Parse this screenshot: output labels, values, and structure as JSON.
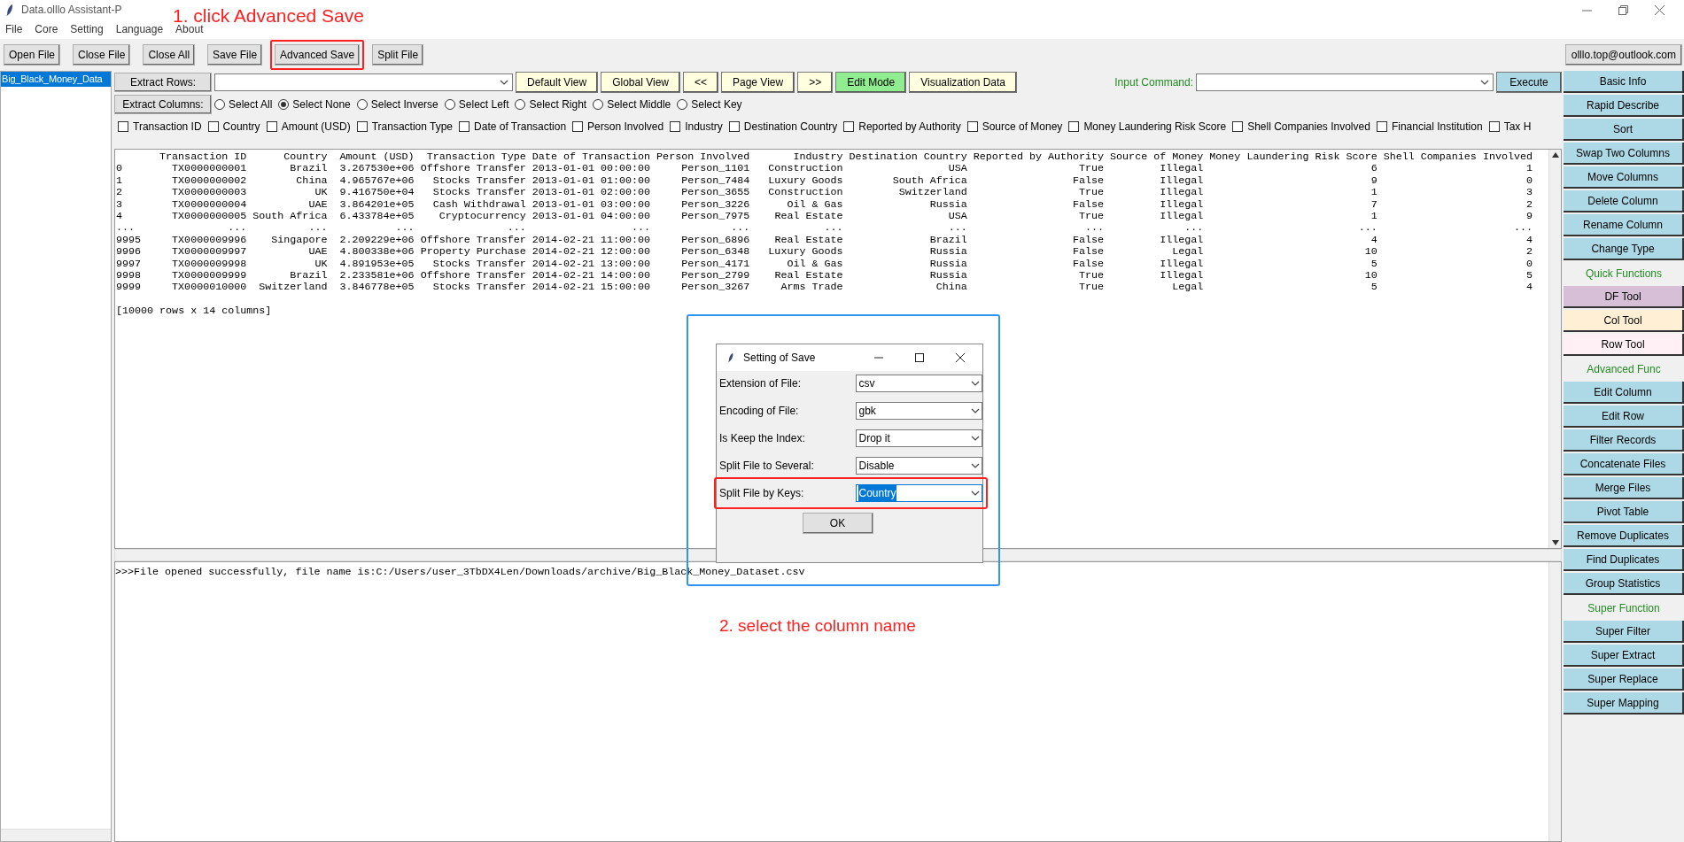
{
  "window": {
    "title": "Data.olllo Assistant-P"
  },
  "menu": [
    "File",
    "Core",
    "Setting",
    "Language",
    "About"
  ],
  "annotations": {
    "step_1": "1. click Advanced Save",
    "step_2": "2. select the column name"
  },
  "toolbar": [
    {
      "label": "Open File",
      "highlighted": false
    },
    {
      "label": "Close File",
      "highlighted": false
    },
    {
      "label": "Close All",
      "highlighted": false
    },
    {
      "label": "Save File",
      "highlighted": false
    },
    {
      "label": "Advanced Save",
      "highlighted": true
    },
    {
      "label": "Split File",
      "highlighted": false
    }
  ],
  "account": "olllo.top@outlook.com",
  "file_list": [
    {
      "label": "Big_Black_Money_Data",
      "selected": true
    }
  ],
  "extract_rows": {
    "label": "Extract Rows:"
  },
  "view_buttons": [
    {
      "label": "Default View",
      "color": "#ffffe0"
    },
    {
      "label": "Global View",
      "color": "#ffffe0"
    },
    {
      "label": "<<",
      "color": "#ffffe0"
    },
    {
      "label": "Page View",
      "color": "#ffffe0"
    },
    {
      "label": ">>",
      "color": "#ffffe0"
    },
    {
      "label": "Edit Mode",
      "color": "#90ee90"
    },
    {
      "label": "Visualization Data",
      "color": "#ffffe0"
    }
  ],
  "command": {
    "label": "Input Command:",
    "button": "Execute"
  },
  "extract_columns": {
    "label": "Extract Columns:"
  },
  "radios": [
    {
      "label": "Select All",
      "selected": false
    },
    {
      "label": "Select None",
      "selected": true
    },
    {
      "label": "Select Inverse",
      "selected": false
    },
    {
      "label": "Select Left",
      "selected": false
    },
    {
      "label": "Select Right",
      "selected": false
    },
    {
      "label": "Select Middle",
      "selected": false
    },
    {
      "label": "Select Key",
      "selected": false
    }
  ],
  "column_checks": [
    {
      "label": "Transaction ID",
      "checked": false
    },
    {
      "label": "Country",
      "checked": false
    },
    {
      "label": "Amount (USD)",
      "checked": false
    },
    {
      "label": "Transaction Type",
      "checked": false
    },
    {
      "label": "Date of Transaction",
      "checked": false
    },
    {
      "label": "Person Involved",
      "checked": false
    },
    {
      "label": "Industry",
      "checked": false
    },
    {
      "label": "Destination Country",
      "checked": false
    },
    {
      "label": "Reported by Authority",
      "checked": false
    },
    {
      "label": "Source of Money",
      "checked": false
    },
    {
      "label": "Money Laundering Risk Score",
      "checked": false
    },
    {
      "label": "Shell Companies Involved",
      "checked": false
    },
    {
      "label": "Financial Institution",
      "checked": false
    },
    {
      "label": "Tax H",
      "checked": false
    }
  ],
  "table": {
    "columns": [
      "Transaction ID",
      "Country",
      "Amount (USD)",
      "Transaction Type",
      "Date of Transaction",
      "Person Involved",
      "Industry",
      "Destination Country",
      "Reported by Authority",
      "Source of Money",
      "Money Laundering Risk Score",
      "Shell Companies Involved"
    ],
    "rows": [
      {
        "index": "0",
        "cells": [
          "TX0000000001",
          "Brazil",
          "3.267530e+06",
          "Offshore Transfer",
          "2013-01-01 00:00:00",
          "Person_1101",
          "Construction",
          "USA",
          "True",
          "Illegal",
          "6",
          "1"
        ]
      },
      {
        "index": "1",
        "cells": [
          "TX0000000002",
          "China",
          "4.965767e+06",
          "Stocks Transfer",
          "2013-01-01 01:00:00",
          "Person_7484",
          "Luxury Goods",
          "South Africa",
          "False",
          "Illegal",
          "9",
          "0"
        ]
      },
      {
        "index": "2",
        "cells": [
          "TX0000000003",
          "UK",
          "9.416750e+04",
          "Stocks Transfer",
          "2013-01-01 02:00:00",
          "Person_3655",
          "Construction",
          "Switzerland",
          "True",
          "Illegal",
          "1",
          "3"
        ]
      },
      {
        "index": "3",
        "cells": [
          "TX0000000004",
          "UAE",
          "3.864201e+05",
          "Cash Withdrawal",
          "2013-01-01 03:00:00",
          "Person_3226",
          "Oil & Gas",
          "Russia",
          "False",
          "Illegal",
          "7",
          "2"
        ]
      },
      {
        "index": "4",
        "cells": [
          "TX0000000005",
          "South Africa",
          "6.433784e+05",
          "Cryptocurrency",
          "2013-01-01 04:00:00",
          "Person_7975",
          "Real Estate",
          "USA",
          "True",
          "Illegal",
          "1",
          "9"
        ]
      },
      {
        "index": "...",
        "cells": [
          "...",
          "...",
          "...",
          "...",
          "...",
          "...",
          "...",
          "...",
          "...",
          "...",
          "...",
          "..."
        ]
      },
      {
        "index": "9995",
        "cells": [
          "TX0000009996",
          "Singapore",
          "2.209229e+06",
          "Offshore Transfer",
          "2014-02-21 11:00:00",
          "Person_6896",
          "Real Estate",
          "Brazil",
          "False",
          "Illegal",
          "4",
          "4"
        ]
      },
      {
        "index": "9996",
        "cells": [
          "TX0000009997",
          "UAE",
          "4.800338e+06",
          "Property Purchase",
          "2014-02-21 12:00:00",
          "Person_6348",
          "Luxury Goods",
          "Russia",
          "False",
          "Legal",
          "10",
          "2"
        ]
      },
      {
        "index": "9997",
        "cells": [
          "TX0000009998",
          "UK",
          "4.891953e+05",
          "Stocks Transfer",
          "2014-02-21 13:00:00",
          "Person_4171",
          "Oil & Gas",
          "Russia",
          "False",
          "Illegal",
          "5",
          "0"
        ]
      },
      {
        "index": "9998",
        "cells": [
          "TX0000009999",
          "Brazil",
          "2.233581e+06",
          "Offshore Transfer",
          "2014-02-21 14:00:00",
          "Person_2799",
          "Real Estate",
          "Russia",
          "True",
          "Illegal",
          "10",
          "5"
        ]
      },
      {
        "index": "9999",
        "cells": [
          "TX0000010000",
          "Switzerland",
          "3.846778e+05",
          "Stocks Transfer",
          "2014-02-21 15:00:00",
          "Person_3267",
          "Arms Trade",
          "China",
          "True",
          "Legal",
          "5",
          "4"
        ]
      }
    ],
    "summary": "[10000 rows x 14 columns]"
  },
  "output": ">>>File opened successfully, file name is:C:/Users/user_3TbDX4Len/Downloads/archive/Big_Black_Money_Dataset.csv",
  "sidebar": [
    {
      "kind": "button",
      "label": "Basic Info",
      "color": "#add8e6"
    },
    {
      "kind": "button",
      "label": "Rapid Describe",
      "color": "#add8e6"
    },
    {
      "kind": "button",
      "label": "Sort",
      "color": "#add8e6"
    },
    {
      "kind": "button",
      "label": "Swap Two Columns",
      "color": "#add8e6"
    },
    {
      "kind": "button",
      "label": "Move Columns",
      "color": "#add8e6"
    },
    {
      "kind": "button",
      "label": "Delete Column",
      "color": "#add8e6"
    },
    {
      "kind": "button",
      "label": "Rename Column",
      "color": "#add8e6"
    },
    {
      "kind": "button",
      "label": "Change Type",
      "color": "#add8e6"
    },
    {
      "kind": "heading",
      "label": "Quick Functions"
    },
    {
      "kind": "button",
      "label": "DF Tool",
      "color": "#d8bfd8"
    },
    {
      "kind": "button",
      "label": "Col Tool",
      "color": "#ffefd5"
    },
    {
      "kind": "button",
      "label": "Row Tool",
      "color": "#fff0f5"
    },
    {
      "kind": "heading",
      "label": "Advanced Func"
    },
    {
      "kind": "button",
      "label": "Edit Column",
      "color": "#add8e6"
    },
    {
      "kind": "button",
      "label": "Edit Row",
      "color": "#add8e6"
    },
    {
      "kind": "button",
      "label": "Filter Records",
      "color": "#add8e6"
    },
    {
      "kind": "button",
      "label": "Concatenate Files",
      "color": "#add8e6"
    },
    {
      "kind": "button",
      "label": "Merge Files",
      "color": "#add8e6"
    },
    {
      "kind": "button",
      "label": "Pivot Table",
      "color": "#add8e6"
    },
    {
      "kind": "button",
      "label": "Remove Duplicates",
      "color": "#add8e6"
    },
    {
      "kind": "button",
      "label": "Find Duplicates",
      "color": "#add8e6"
    },
    {
      "kind": "button",
      "label": "Group Statistics",
      "color": "#add8e6"
    },
    {
      "kind": "heading",
      "label": "Super Function"
    },
    {
      "kind": "button",
      "label": "Super Filter",
      "color": "#add8e6"
    },
    {
      "kind": "button",
      "label": "Super Extract",
      "color": "#add8e6"
    },
    {
      "kind": "button",
      "label": "Super Replace",
      "color": "#add8e6"
    },
    {
      "kind": "button",
      "label": "Super Mapping",
      "color": "#add8e6"
    }
  ],
  "dialog": {
    "title": "Setting of Save",
    "framed": true,
    "fields": [
      {
        "label": "Extension of File:",
        "value": "csv",
        "selected": false,
        "highlighted": false
      },
      {
        "label": "Encoding of File:",
        "value": "gbk",
        "selected": false,
        "highlighted": false
      },
      {
        "label": "Is Keep the Index:",
        "value": "Drop it",
        "selected": false,
        "highlighted": false
      },
      {
        "label": "Split File to Several:",
        "value": "Disable",
        "selected": false,
        "highlighted": false
      },
      {
        "label": "Split File by Keys:",
        "value": "Country",
        "selected": true,
        "highlighted": true
      }
    ],
    "button": "OK"
  }
}
